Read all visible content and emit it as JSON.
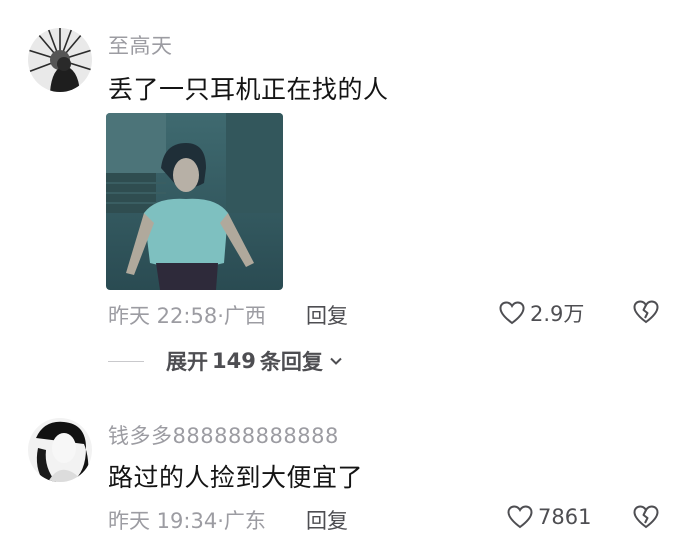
{
  "comments": [
    {
      "username": "至高天",
      "text": "丢了一只耳机正在找的人",
      "time": "昨天 22:58",
      "location": "广西",
      "reply_label": "回复",
      "likes": "2.9万",
      "replies": {
        "prefix": "展开",
        "count": "149",
        "suffix": "条回复"
      }
    },
    {
      "username": "钱多多888888888888",
      "text": "路过的人捡到大便宜了",
      "time": "昨天 19:34",
      "location": "广东",
      "reply_label": "回复",
      "likes": "7861"
    }
  ],
  "icons": {
    "like": "heart-outline-icon",
    "dislike": "broken-heart-icon",
    "expand": "chevron-down-icon"
  },
  "colors": {
    "meta": "#9c9ca2",
    "action": "#4e4e52",
    "text": "#141414"
  }
}
